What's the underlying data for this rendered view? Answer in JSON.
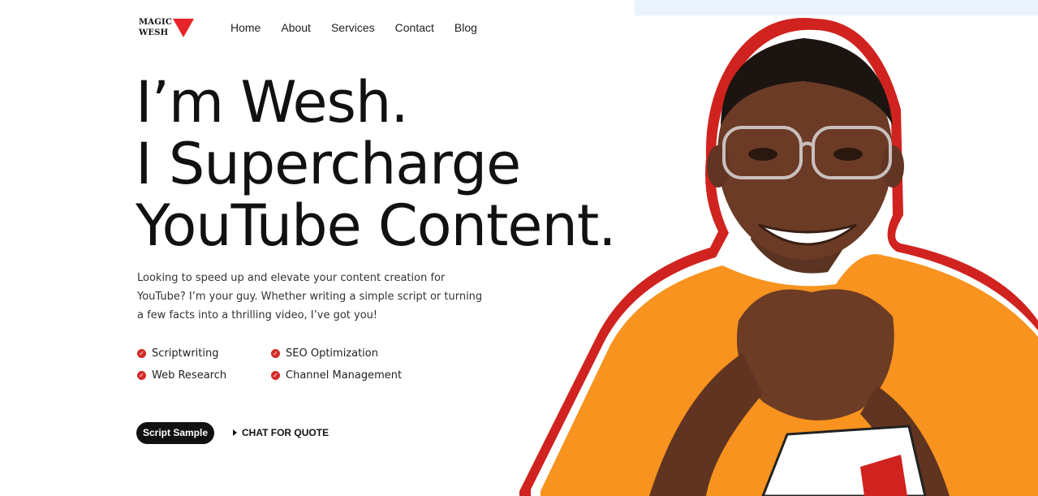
{
  "logo": {
    "line1": "MAGIC",
    "line2": "WESH",
    "accent_color": "#e8232a"
  },
  "nav": {
    "items": [
      {
        "label": "Home"
      },
      {
        "label": "About"
      },
      {
        "label": "Services"
      },
      {
        "label": "Contact"
      },
      {
        "label": "Blog"
      }
    ]
  },
  "hero": {
    "headline_lines": [
      "I’m Wesh.",
      "I Supercharge",
      "YouTube Content."
    ],
    "description": "Looking to speed up and elevate your content creation for YouTube? I’m your guy. Whether writing a simple script or turning a few facts into a thrilling video, I’ve got you!",
    "features": [
      {
        "label": "Scriptwriting",
        "icon": "check-circle-icon"
      },
      {
        "label": "SEO Optimization",
        "icon": "check-circle-icon"
      },
      {
        "label": "Web Research",
        "icon": "check-circle-icon"
      },
      {
        "label": "Channel Management",
        "icon": "check-circle-icon"
      }
    ],
    "primary_button": "Script Sample",
    "secondary_button": "CHAT FOR QUOTE"
  },
  "colors": {
    "accent": "#d22b27",
    "shirt": "#f7931e",
    "background_panel": "#eaf3fe"
  }
}
